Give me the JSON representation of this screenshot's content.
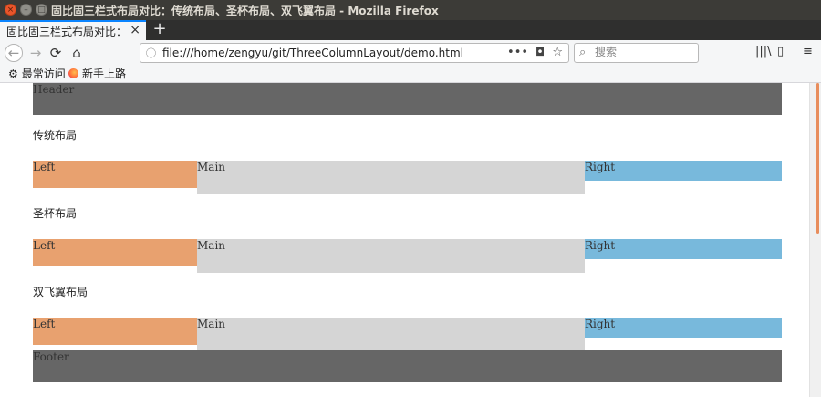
{
  "window": {
    "title": "固比固三栏式布局对比：传统布局、圣杯布局、双飞翼布局 - Mozilla Firefox"
  },
  "tab": {
    "label": "固比固三栏式布局对比：传统布局",
    "close_glyph": "×",
    "new_tab_glyph": "+"
  },
  "navbar": {
    "url": "file:///home/zengyu/git/ThreeColumnLayout/demo.html",
    "search_placeholder": "搜索",
    "page_actions_glyph": "•••"
  },
  "bookmarks": {
    "items": [
      {
        "label": "最常访问",
        "icon": "gear-icon"
      },
      {
        "label": "新手上路",
        "icon": "firefox-icon"
      }
    ]
  },
  "page": {
    "header": "Header",
    "footer": "Footer",
    "sections": [
      {
        "heading": "传统布局",
        "left": "Left",
        "main": "Main",
        "right": "Right"
      },
      {
        "heading": "圣杯布局",
        "left": "Left",
        "main": "Main",
        "right": "Right"
      },
      {
        "heading": "双飞翼布局",
        "left": "Left",
        "main": "Main",
        "right": "Right"
      }
    ]
  },
  "colors": {
    "header_footer": "#666666",
    "left": "#e8a16f",
    "main": "#d5d5d5",
    "right": "#78b9dc",
    "accent": "#0a84ff"
  }
}
